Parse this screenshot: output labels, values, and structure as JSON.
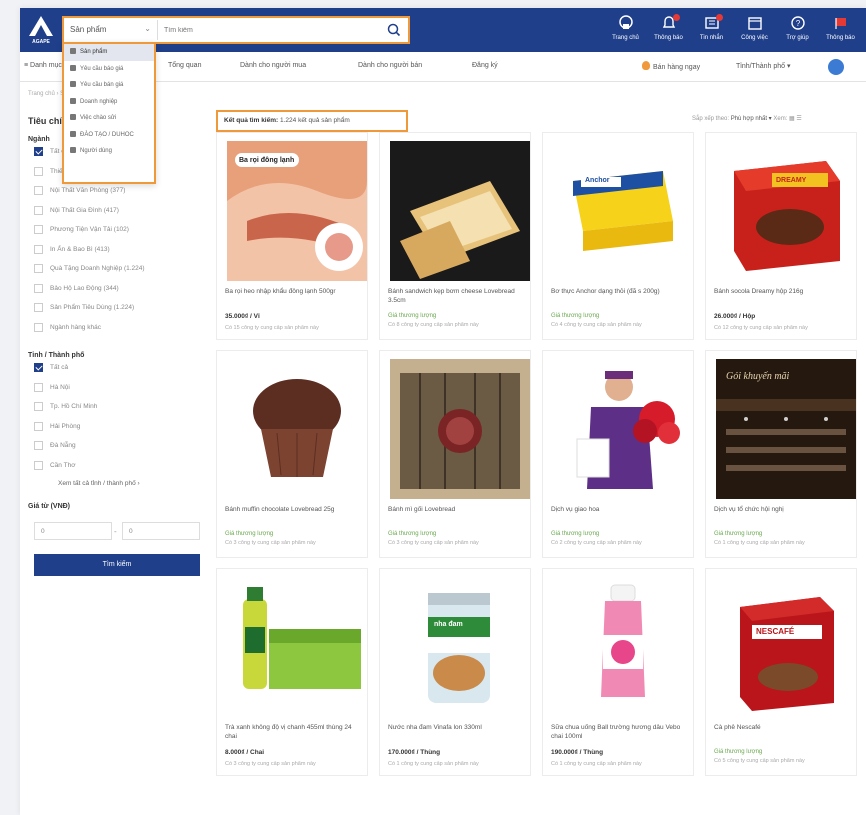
{
  "brand": {
    "logo_text": "AGAPE",
    "accent": "#f0993a",
    "primary": "#1f3f8b"
  },
  "search": {
    "category": "Sản phẩm",
    "placeholder": "Tìm kiếm"
  },
  "category_dropdown": [
    {
      "label": "Sản phẩm",
      "icon": "box-icon"
    },
    {
      "label": "Yêu cầu báo giá",
      "icon": "quote-icon"
    },
    {
      "label": "Yêu cầu bán giá",
      "icon": "sell-icon"
    },
    {
      "label": "Doanh nghiệp",
      "icon": "building-icon"
    },
    {
      "label": "Việc chào sửi",
      "icon": "job-icon"
    },
    {
      "label": "ĐÀO TẠO / DUHOC",
      "icon": "school-icon"
    },
    {
      "label": "Người dùng",
      "icon": "user-icon"
    }
  ],
  "top_icons": [
    {
      "label": "Trang chủ",
      "icon": "home-icon",
      "badge": false
    },
    {
      "label": "Thông báo",
      "icon": "bell-icon",
      "badge": true
    },
    {
      "label": "Tin nhắn",
      "icon": "message-icon",
      "badge": true
    },
    {
      "label": "Công việc",
      "icon": "calendar-icon",
      "badge": false
    },
    {
      "label": "Trợ giúp",
      "icon": "help-icon",
      "badge": false
    },
    {
      "label": "Thông báo",
      "icon": "flag-icon",
      "badge": false
    }
  ],
  "nav": {
    "items": [
      "≡ Danh mục",
      "Tổng quan",
      "Dành cho người mua",
      "Dành cho người bán",
      "Đăng ký"
    ],
    "sell_label": "Bán hàng ngay",
    "city_label": "Tỉnh/Thành phố ▾"
  },
  "breadcrumb": "Trang chủ › Sản phẩm › Tìm kiếm",
  "sidebar": {
    "title": "Tiêu chí",
    "industry_heading": "Ngành",
    "industries": [
      {
        "label": "Tất cả",
        "checked": true
      },
      {
        "label": "Thiết Bị Văn Phòng (276)",
        "checked": false
      },
      {
        "label": "Nội Thất Văn Phòng (377)",
        "checked": false
      },
      {
        "label": "Nội Thất Gia Đình (417)",
        "checked": false
      },
      {
        "label": "Phương Tiện Vận Tải (102)",
        "checked": false
      },
      {
        "label": "In Ấn & Bao Bì (413)",
        "checked": false
      },
      {
        "label": "Quà Tặng Doanh Nghiệp (1.224)",
        "checked": false
      },
      {
        "label": "Bảo Hộ Lao Động (344)",
        "checked": false
      },
      {
        "label": "Sản Phẩm Tiêu Dùng (1.224)",
        "checked": false
      },
      {
        "label": "Ngành hàng khác",
        "checked": false
      }
    ],
    "city_heading": "Tỉnh / Thành phố",
    "cities": [
      {
        "label": "Tất cả",
        "checked": true
      },
      {
        "label": "Hà Nội",
        "checked": false
      },
      {
        "label": "Tp. Hồ Chí Minh",
        "checked": false
      },
      {
        "label": "Hải Phòng",
        "checked": false
      },
      {
        "label": "Đà Nẵng",
        "checked": false
      },
      {
        "label": "Cần Thơ",
        "checked": false
      }
    ],
    "more_cities": "Xem tất cả tỉnh / thành phố ›",
    "price_heading": "Giá từ (VNĐ)",
    "price_from": "0",
    "price_to": "0",
    "submit": "Tìm kiếm"
  },
  "results": {
    "label": "Kết quả tìm kiếm:",
    "count": "1.224 kết quả sản phẩm",
    "sort_label": "Sắp xếp theo:",
    "sort_value": "Phù hợp nhất ▾",
    "view_label": "Xem:"
  },
  "products": [
    {
      "name": "Ba rọi heo nhập khẩu đông lạnh 500gr",
      "price": "35.000₫ / Vỉ",
      "status": "",
      "meta": "Có 15 công ty cung cấp sản phẩm này",
      "image_label": "Ba rọi đông lạnh"
    },
    {
      "name": "Bánh sandwich kẹp bơm cheese Lovebread 3.5cm",
      "price": "",
      "status": "Giá thương lượng",
      "meta": "Có 8 công ty cung cấp sản phẩm này",
      "image_label": ""
    },
    {
      "name": "Bơ thực Anchor dạng thỏi (đã s 200g)",
      "price": "",
      "status": "Giá thương lượng",
      "meta": "Có 4 công ty cung cấp sản phẩm này",
      "image_label": "Anchor"
    },
    {
      "name": "Bánh socola Dreamy hộp 216g",
      "price": "26.000₫ / Hộp",
      "status": "",
      "meta": "Có 12 công ty cung cấp sản phẩm này",
      "image_label": "DREAMY"
    },
    {
      "name": "Bánh muffin chocolate Lovebread 25g",
      "price": "",
      "status": "Giá thương lượng",
      "meta": "Có 3 công ty cung cấp sản phẩm này",
      "image_label": ""
    },
    {
      "name": "Bánh mì gối Lovebread",
      "price": "",
      "status": "Giá thương lượng",
      "meta": "Có 3 công ty cung cấp sản phẩm này",
      "image_label": ""
    },
    {
      "name": "Dịch vụ giao hoa",
      "price": "",
      "status": "Giá thương lượng",
      "meta": "Có 2 công ty cung cấp sản phẩm này",
      "image_label": ""
    },
    {
      "name": "Dịch vụ tổ chức hội nghị",
      "price": "",
      "status": "Giá thương lượng",
      "meta": "Có 1 công ty cung cấp sản phẩm này",
      "image_label": "Gói khuyến mãi"
    },
    {
      "name": "Trà xanh không độ vị chanh 455ml thùng 24 chai",
      "price": "8.000₫ / Chai",
      "status": "",
      "meta": "Có 3 công ty cung cấp sản phẩm này",
      "image_label": ""
    },
    {
      "name": "Nước nha đam Vinafa lon 330ml",
      "price": "170.000₫ / Thùng",
      "status": "",
      "meta": "Có 1 công ty cung cấp sản phẩm này",
      "image_label": "nha đam"
    },
    {
      "name": "Sữa chua uống Ball trường hương dâu Vebo chai 100ml",
      "price": "190.000₫ / Thùng",
      "status": "",
      "meta": "Có 1 công ty cung cấp sản phẩm này",
      "image_label": ""
    },
    {
      "name": "Cà phê Nescafé",
      "price": "",
      "status": "Giá thương lượng",
      "meta": "Có 5 công ty cung cấp sản phẩm này",
      "image_label": "NESCAFÉ"
    }
  ]
}
